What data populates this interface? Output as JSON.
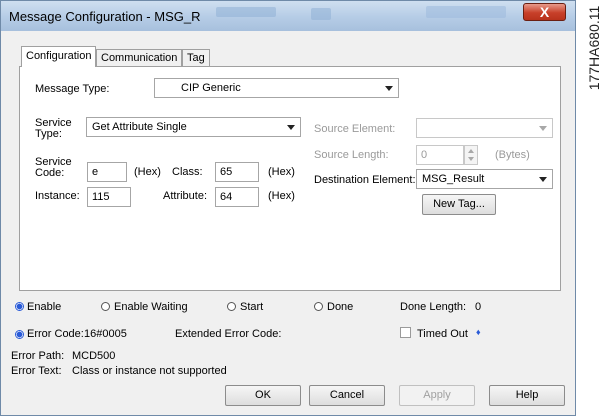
{
  "window": {
    "title": "Message Configuration - MSG_R",
    "close_glyph": "X"
  },
  "tabs": [
    "Configuration",
    "Communication",
    "Tag"
  ],
  "config": {
    "message_type_label": "Message Type:",
    "message_type_value": "CIP Generic",
    "service_type_label": "Service Type:",
    "service_type_value": "Get Attribute Single",
    "service_code_label": "Service Code:",
    "service_code_value": "e",
    "service_code_unit": "(Hex)",
    "class_label": "Class:",
    "class_value": "65",
    "class_unit": "(Hex)",
    "instance_label": "Instance:",
    "instance_value": "115",
    "attribute_label": "Attribute:",
    "attribute_value": "64",
    "attribute_unit": "(Hex)",
    "source_element_label": "Source Element:",
    "source_element_value": "",
    "source_length_label": "Source Length:",
    "source_length_value": "0",
    "source_length_unit": "(Bytes)",
    "destination_element_label": "Destination Element:",
    "destination_element_value": "MSG_Result",
    "new_tag_button": "New Tag..."
  },
  "status": {
    "enable": "Enable",
    "enable_waiting": "Enable Waiting",
    "start": "Start",
    "done": "Done",
    "done_length_label": "Done Length:",
    "done_length_value": "0",
    "error_code_label": "Error Code:",
    "error_code_value": "16#0005",
    "extended_error_code_label": "Extended Error Code:",
    "timed_out_label": "Timed Out",
    "timed_out_marker": "♦",
    "error_path_label": "Error Path:",
    "error_path_value": "MCD500",
    "error_text_label": "Error Text:",
    "error_text_value": "Class or instance not supported"
  },
  "buttons": {
    "ok": "OK",
    "cancel": "Cancel",
    "apply": "Apply",
    "help": "Help"
  },
  "side_code": "177HA680.11",
  "colors": {
    "accent": "#2a5bd7",
    "close_button": "#c8402a",
    "titlebar": "#b5cce6"
  }
}
